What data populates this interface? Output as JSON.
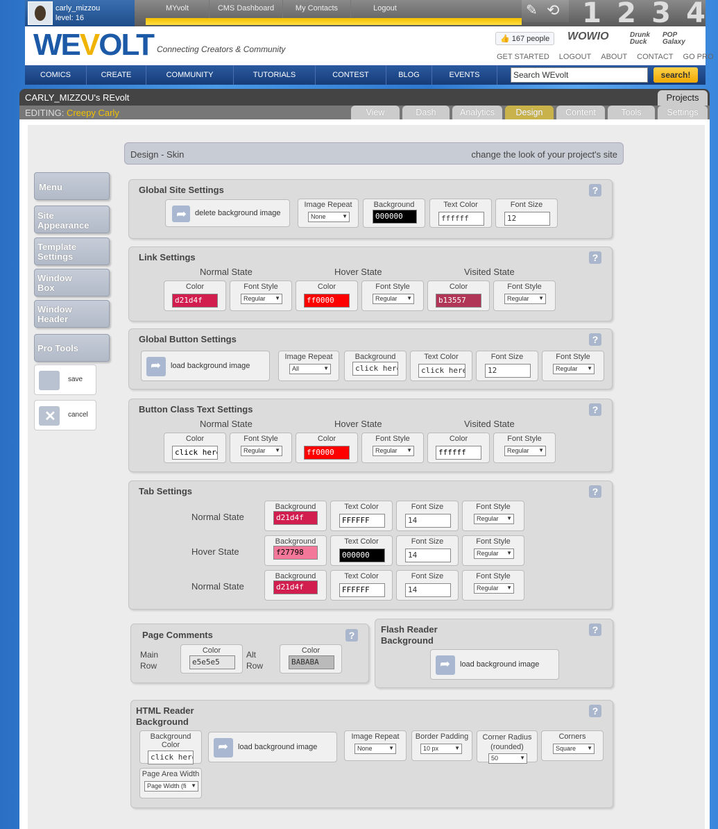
{
  "topbar": {
    "username": "carly_mizzou",
    "level": "level: 16",
    "nav": [
      "MYvolt",
      "CMS Dashboard",
      "My Contacts",
      "Logout"
    ],
    "numbers": [
      "1",
      "2",
      "3",
      "4"
    ]
  },
  "header": {
    "logo_a": "WE",
    "logo_v": "V",
    "logo_b": "OLT",
    "tagline": "Connecting Creators & Community",
    "likes": "167 people",
    "brands": [
      "WOWIO",
      "Drunk Duck",
      "POP Galaxy"
    ],
    "links": [
      "GET STARTED",
      "LOGOUT",
      "ABOUT",
      "CONTACT",
      "GO PRO"
    ]
  },
  "mainnav": {
    "items": [
      "COMICS",
      "CREATE",
      "COMMUNITY",
      "TUTORIALS",
      "CONTEST",
      "BLOG",
      "EVENTS"
    ],
    "search_value": "Search WEvolt",
    "search_btn": "search!"
  },
  "project": {
    "title": "CARLY_MIZZOU's REvolt",
    "projects_tab": "Projects",
    "editing_label": "EDITING:",
    "editing_name": "Creepy Carly",
    "tabs": [
      "View",
      "Dash",
      "Analytics",
      "Design",
      "Content",
      "Tools",
      "Settings"
    ],
    "active_tab": "Design"
  },
  "design": {
    "title": "Design - Skin",
    "subtitle": "change the look of your project's site"
  },
  "sidebar": {
    "items": [
      "Menu",
      "Site Appearance",
      "Template Settings",
      "Window Box",
      "Window Header",
      "Pro Tools"
    ],
    "save": "save",
    "cancel": "cancel"
  },
  "global_site": {
    "title": "Global Site Settings",
    "delete_bg": "delete background image",
    "image_repeat_label": "Image Repeat",
    "image_repeat": "None",
    "bg_color_label": "Background Color",
    "bg_color": "000000",
    "text_color_label": "Text Color",
    "text_color": "ffffff",
    "font_size_label": "Font Size",
    "font_size": "12"
  },
  "link": {
    "title": "Link Settings",
    "states": [
      "Normal State",
      "Hover State",
      "Visited State"
    ],
    "color_label": "Color",
    "font_style_label": "Font Style",
    "colors": [
      "d21d4f",
      "ff0000",
      "b13557"
    ],
    "swatches": [
      "#d21d4f",
      "#ff0000",
      "#b13557"
    ],
    "font_styles": [
      "Regular",
      "Regular",
      "Regular"
    ]
  },
  "global_button": {
    "title": "Global Button Settings",
    "load_bg": "load background image",
    "image_repeat_label": "Image Repeat",
    "image_repeat": "All",
    "bg_color_label": "Background Color",
    "bg_color": "click here fo",
    "text_color_label": "Text Color",
    "text_color": "click here fo",
    "font_size_label": "Font Size",
    "font_size": "12",
    "font_style_label": "Font Style",
    "font_style": "Regular"
  },
  "button_class": {
    "title": "Button Class Text Settings",
    "states": [
      "Normal State",
      "Hover State",
      "Visited State"
    ],
    "color_label": "Color",
    "font_style_label": "Font Style",
    "colors": [
      "click here fo",
      "ff0000",
      "ffffff"
    ],
    "swatches": [
      "#ffffff",
      "#ff0000",
      "#ffffff"
    ],
    "font_styles": [
      "Regular",
      "Regular",
      "Regular"
    ]
  },
  "tab_settings": {
    "title": "Tab Settings",
    "bg_label": "Background Color",
    "text_label": "Text Color",
    "size_label": "Font Size",
    "style_label": "Font Style",
    "rows": [
      {
        "state": "Normal State",
        "bg": "d21d4f",
        "bg_hex": "#d21d4f",
        "text": "FFFFFF",
        "text_hex": "#ffffff",
        "size": "14",
        "style": "Regular"
      },
      {
        "state": "Hover State",
        "bg": "f27798",
        "bg_hex": "#f27798",
        "text": "000000",
        "text_hex": "#000000",
        "size": "14",
        "style": "Regular"
      },
      {
        "state": "Normal State",
        "bg": "d21d4f",
        "bg_hex": "#d21d4f",
        "text": "FFFFFF",
        "text_hex": "#ffffff",
        "size": "14",
        "style": "Regular"
      }
    ]
  },
  "page_comments": {
    "title": "Page Comments",
    "main": "Main Row",
    "alt": "Alt Row",
    "color_label": "Color",
    "main_color": "e5e5e5",
    "alt_color": "BABABA"
  },
  "flash_reader": {
    "title": "Flash Reader Background",
    "load_bg": "load background image"
  },
  "html_reader": {
    "title": "HTML Reader Background",
    "bg_label": "Background Color",
    "bg_value": "click here fo",
    "load_bg": "load background image",
    "image_repeat_label": "Image Repeat",
    "image_repeat": "None",
    "border_padding_label": "Border Padding",
    "border_padding": "10 px",
    "corner_radius_label": "Corner Radius (rounded)",
    "corner_radius": "50",
    "corners_label": "Corners",
    "corners": "Square",
    "page_width_label": "Page Area Width",
    "page_width": "Page Width (fi"
  },
  "help_glyph": "?"
}
